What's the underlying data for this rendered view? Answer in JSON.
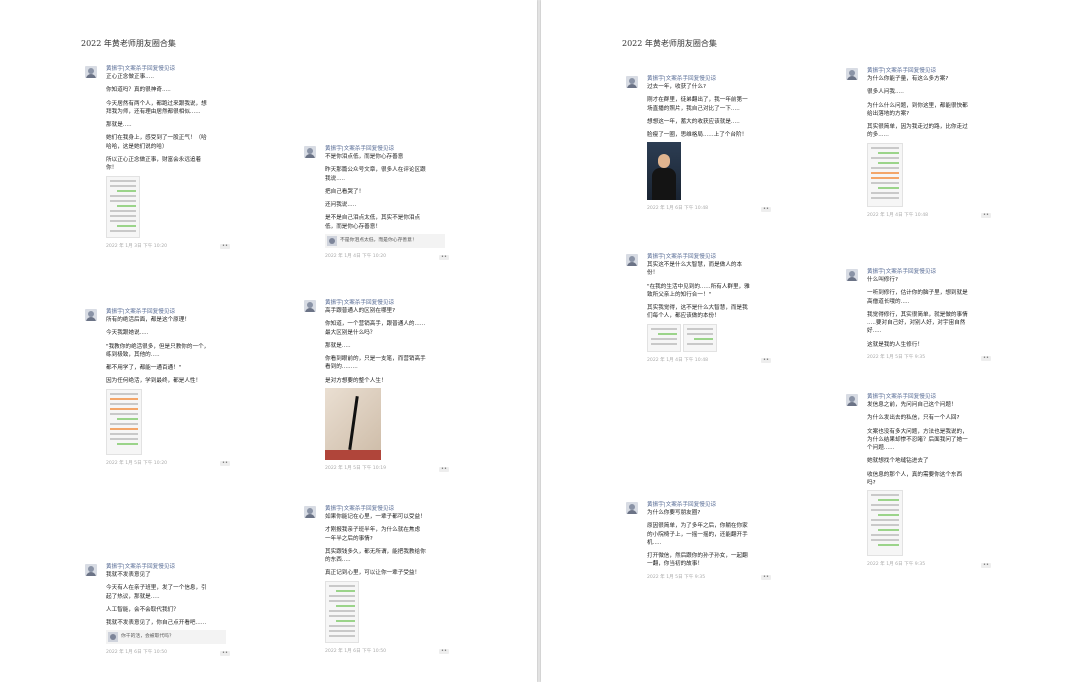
{
  "pages": {
    "left": {
      "title": "2022 年黄老师朋友圈合集",
      "posts": [
        {
          "author": "黄振宇|文案杀手回复慢见谅",
          "lines": [
            "正心正念做正事.....",
            "",
            "你知道吗？真的很神奇.....",
            "",
            "今天居然有两个人，都跑过来跟我说，想",
            "拜我为师，还有理由居然都很相似......",
            "",
            "那就是.....",
            "",
            "她们在我身上，感受到了一股正气！（哈",
            "哈哈，这是她们说的哈）",
            "",
            "所以正心正念做正事，财富会永远追着",
            "你！"
          ],
          "time": "2022 年 1月 3日 下午 10:20"
        },
        {
          "author": "黄振宇|文案杀手回复慢见谅",
          "lines": [
            "所有的绝活后面，都是这个原理！",
            "",
            "今天我跟她说.....",
            "",
            "\"我教你的绝活很多，但是只教你的一个，",
            "练到极致，其他的.....",
            "",
            "都不用学了，都能一通百通！\"",
            "",
            "因为任何绝活，学到最终，都是人性！"
          ],
          "time": "2022 年 1月 5日 下午 10:20"
        },
        {
          "author": "黄振宇|文案杀手回复慢见谅",
          "lines": [
            "我就不发表意见了",
            "",
            "今天有人在亲子班里，发了一个信息，引",
            "起了热议，那就是.....",
            "",
            "人工智能，会不会取代我们？",
            "",
            "我就不发表意见了，你自己点开看吧......"
          ],
          "quote": "你干的活，会被取代吗？",
          "time": "2022 年 1月 6日 下午 10:50"
        },
        {
          "author": "黄振宇|文案杀手回复慢见谅",
          "lines": [
            "不是你泪点低，而是你心存善意",
            "",
            "昨天那篇公众号文章，很多人在评论区跟",
            "我说.....",
            "",
            "把自己看哭了！",
            "",
            "还问我说.....",
            "",
            "是不是自己泪点太低，其实不是你泪点",
            "低，而是你心存善意！"
          ],
          "quote": "不是你泪点太低，而是你心存善意！",
          "time": "2022 年 1月 4日 下午 10:20"
        },
        {
          "author": "黄振宇|文案杀手回复慢见谅",
          "lines": [
            "高手跟普通人的区别在哪里?",
            "",
            "你知道，一个营销高手，跟普通人的......",
            "最大区别是什么吗？",
            "",
            "那就是.....",
            "",
            "你看到眼前的，只是一支笔，而营销高手",
            "看到的.........",
            "",
            "是对方想要的整个人生！"
          ],
          "time": "2022 年 1月 5日 下午 10:19"
        },
        {
          "author": "黄振宇|文案杀手回复慢见谅",
          "lines": [
            "如果你能记在心里，一辈子都可以受益！",
            "",
            "才刚报我亲子班半年，为什么就在焦虑",
            "一年半之后的事情?",
            "",
            "其实跟钱多久，都无所谓，能把我教给你",
            "的东西.....",
            "",
            "真正记到心里，可以让你一辈子受益！"
          ],
          "time": "2022 年 1月 6日 下午 10:50"
        }
      ]
    },
    "right": {
      "title": "2022 年黄老师朋友圈合集",
      "posts": [
        {
          "author": "黄振宇|文案杀手回复慢见谅",
          "lines": [
            "过去一年，收获了什么?",
            "",
            "刚才在群里，徒弟翻出了，我一年前第一",
            "场直播的照片，我自己对比了一下.....",
            "",
            "想想这一年，蓄大的收获应该就是.....",
            "",
            "脸瘦了一圈，思维格局......上了个台阶！"
          ],
          "time": "2022 年 1月 6日 下午 10:48"
        },
        {
          "author": "黄振宇|文案杀手回复慢见谅",
          "lines": [
            "其实这不是什么大智慧，而是做人的本",
            "份！",
            "",
            "\"在我的生活中见到的......所有人群里，雅",
            "致所父亲上的知行合一！\"",
            "",
            "其实我觉得，这不是什么大智慧，而是我",
            "们每个人，都应该做的本份！"
          ],
          "time": "2022 年 1月 4日 下午 10:48"
        },
        {
          "author": "黄振宇|文案杀手回复慢见谅",
          "lines": [
            "为什么你要写朋友圈?",
            "",
            "原因很简单，为了多年之后，你躺在你家",
            "的小院椅子上，一摇一摇的，还能翻开手",
            "机.....",
            "",
            "打开微信，然后跟你的孙子孙女，一起翻",
            "一翻，你当初的故事！"
          ],
          "time": "2022 年 1月 5日 下午 9:35"
        },
        {
          "author": "黄振宇|文案杀手回复慢见谅",
          "lines": [
            "为什么你能子量，有这么多方案?",
            "",
            "很多人问我.....",
            "",
            "为什么什么问题，到你这里，都能很快都",
            "给出落地的方案?",
            "",
            "其实很简单，因为我走过的路，比你走过",
            "的多......"
          ],
          "time": "2022 年 1月 4日 下午 10:48"
        },
        {
          "author": "黄振宇|文案杀手回复慢见谅",
          "lines": [
            "什么叫修行?",
            "",
            "一听到修行，估计你的脑子里，想到就是",
            "高僧道长哦的.....",
            "",
            "我觉得修行，其实很简单，就是做的事情",
            ".....要对自己好，对别人好，对宇宙自然",
            "好.....",
            "",
            "这就是我的人生修行！"
          ],
          "time": "2022 年 1月 5日 下午 9:35"
        },
        {
          "author": "黄振宇|文案杀手回复慢见谅",
          "lines": [
            "发信息之前，先问问自己这个问题！",
            "",
            "为什么发出去的私信，只有一个人回?",
            "",
            "文案也没有多大问题，方法也是我说的，",
            "为什么结果却惨不忍睹？后面我问了她一",
            "个问题......",
            "",
            "她就想找个地缝钻进去了",
            "",
            "收信息的那个人，真的需要你这个东西",
            "吗?"
          ],
          "time": "2022 年 1月 6日 下午 9:35"
        }
      ]
    }
  }
}
